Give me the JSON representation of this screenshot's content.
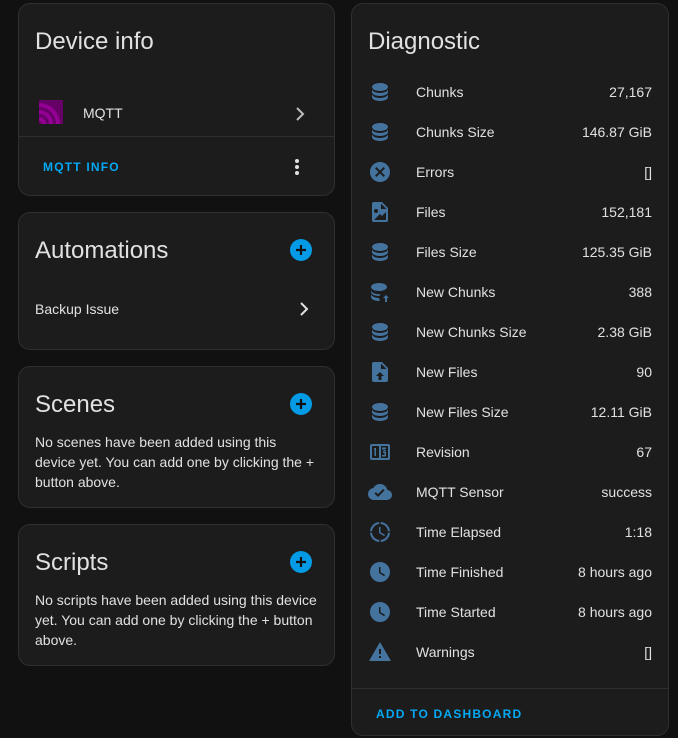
{
  "device_info": {
    "title": "Device info",
    "integration": {
      "name": "MQTT",
      "icon": "mqtt-logo-icon"
    },
    "mqtt_info_label": "MQTT INFO"
  },
  "automations": {
    "title": "Automations",
    "items": [
      {
        "label": "Backup Issue"
      }
    ]
  },
  "scenes": {
    "title": "Scenes",
    "empty_text": "No scenes have been added using this device yet. You can add one by clicking the + button above."
  },
  "scripts": {
    "title": "Scripts",
    "empty_text": "No scripts have been added using this device yet. You can add one by clicking the + button above."
  },
  "diagnostic": {
    "title": "Diagnostic",
    "rows": [
      {
        "label": "Chunks",
        "value": "27,167",
        "icon": "database-icon"
      },
      {
        "label": "Chunks Size",
        "value": "146.87 GiB",
        "icon": "database-icon"
      },
      {
        "label": "Errors",
        "value": "[]",
        "icon": "close-circle-icon"
      },
      {
        "label": "Files",
        "value": "152,181",
        "icon": "file-image-icon"
      },
      {
        "label": "Files Size",
        "value": "125.35 GiB",
        "icon": "database-icon"
      },
      {
        "label": "New Chunks",
        "value": "388",
        "icon": "database-arrow-up-icon"
      },
      {
        "label": "New Chunks Size",
        "value": "2.38 GiB",
        "icon": "database-icon"
      },
      {
        "label": "New Files",
        "value": "90",
        "icon": "file-upload-icon"
      },
      {
        "label": "New Files Size",
        "value": "12.11 GiB",
        "icon": "database-icon"
      },
      {
        "label": "Revision",
        "value": "67",
        "icon": "counter-icon"
      },
      {
        "label": "MQTT Sensor",
        "value": "success",
        "icon": "cloud-check-icon"
      },
      {
        "label": "Time Elapsed",
        "value": "1:18",
        "icon": "clock-outline-icon"
      },
      {
        "label": "Time Finished",
        "value": "8 hours ago",
        "icon": "clock-icon"
      },
      {
        "label": "Time Started",
        "value": "8 hours ago",
        "icon": "clock-icon"
      },
      {
        "label": "Warnings",
        "value": "[]",
        "icon": "alert-icon"
      }
    ],
    "add_to_dashboard_label": "ADD TO DASHBOARD"
  },
  "colors": {
    "background": "#111111",
    "card": "#1c1c1c",
    "accent": "#03a9f4",
    "icon": "#44739e",
    "mqtt": "#660066"
  }
}
